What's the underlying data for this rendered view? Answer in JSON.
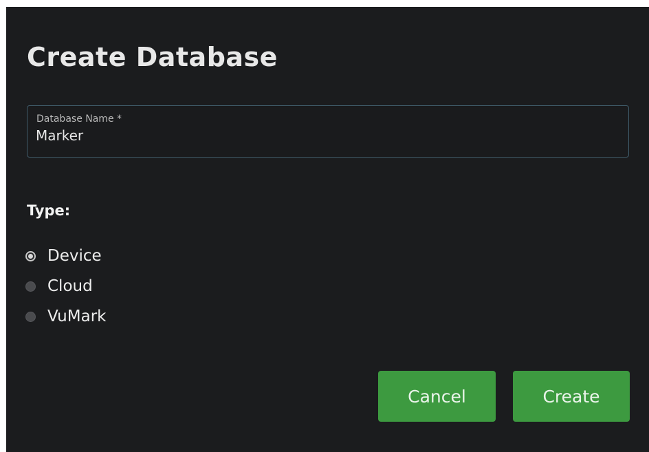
{
  "dialog": {
    "title": "Create Database",
    "name_field": {
      "label": "Database Name *",
      "value": "Marker"
    },
    "type_section": {
      "label": "Type:",
      "options": [
        {
          "label": "Device",
          "checked": true
        },
        {
          "label": "Cloud",
          "checked": false
        },
        {
          "label": "VuMark",
          "checked": false
        }
      ]
    },
    "buttons": {
      "cancel_label": "Cancel",
      "create_label": "Create"
    },
    "colors": {
      "background": "#1b1c1e",
      "button_green": "#3d9a40",
      "field_border": "#3f5a68"
    }
  }
}
